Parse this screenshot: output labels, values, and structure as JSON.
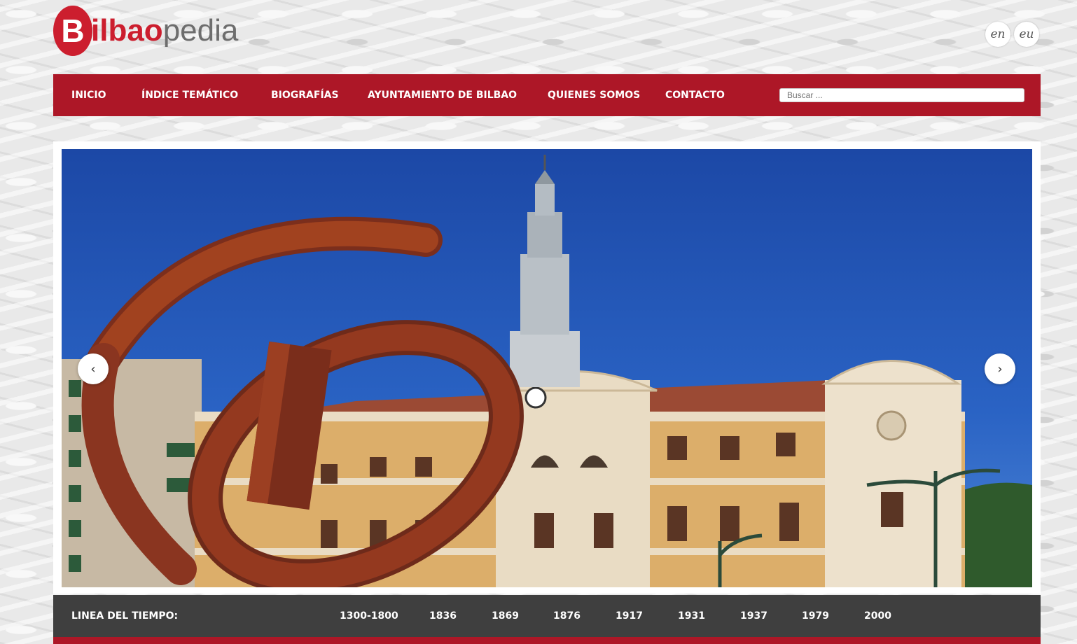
{
  "logo": {
    "letter_b": "B",
    "text_red": "ilbao",
    "text_gray": "pedia"
  },
  "languages": [
    "en",
    "eu"
  ],
  "nav": {
    "items": [
      "INICIO",
      "ÍNDICE TEMÁTICO",
      "BIOGRAFÍAS",
      "AYUNTAMIENTO DE BILBAO",
      "QUIENES SOMOS",
      "CONTACTO"
    ],
    "search_placeholder": "Buscar ..."
  },
  "slider": {
    "prev_icon": "chevron-left-icon",
    "next_icon": "chevron-right-icon",
    "prev_glyph": "‹",
    "next_glyph": "›"
  },
  "timeline": {
    "label": "LINEA DEL TIEMPO:",
    "years": [
      "1300-1800",
      "1836",
      "1869",
      "1876",
      "1917",
      "1931",
      "1937",
      "1979",
      "2000"
    ]
  },
  "colors": {
    "brand_red": "#ad1727",
    "logo_red": "#cc1e2e",
    "timeline_bg": "#3f3f3f"
  }
}
